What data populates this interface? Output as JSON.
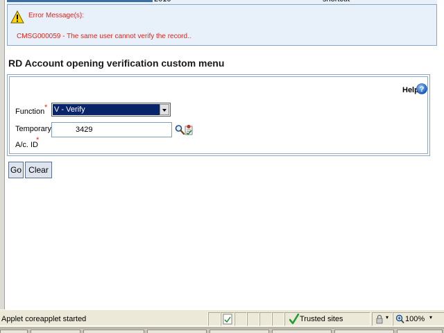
{
  "top_strip": {
    "cropped_text_left": "2010",
    "cropped_text_right": "shortcut"
  },
  "error": {
    "title": "Error Message(s):",
    "message": "CMSG000059 - The same user cannot verify the record..",
    "icon": "warning-icon",
    "color": "#e2231a"
  },
  "page": {
    "title": "RD Account opening verification custom menu"
  },
  "form": {
    "help_label": "Help",
    "help_icon": "help-icon",
    "function_label": "Function",
    "function_required": "*",
    "function_value": "V - Verify",
    "temp_label": "Temporary",
    "acid_label": "A/c. ID",
    "acid_required": "*",
    "acid_value": "3429",
    "search_icon": "search-icon",
    "verify_icon": "verify-icon"
  },
  "buttons": {
    "go": "Go",
    "clear": "Clear"
  },
  "status_bar": {
    "status_text": "Applet coreapplet started",
    "zone_text": "Trusted sites",
    "zoom": "100%"
  }
}
